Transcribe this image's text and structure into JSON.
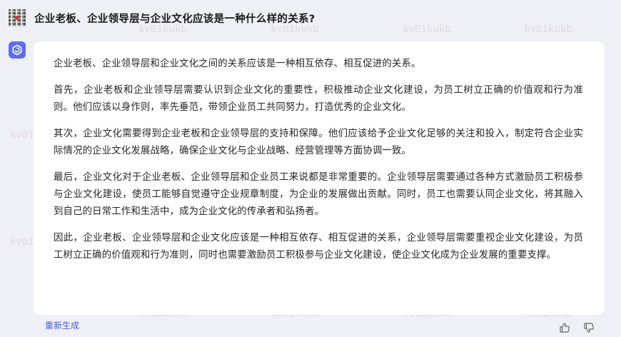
{
  "question": "企业老板、企业领导层与企业文化应该是一种什么样的关系?",
  "answer": {
    "paragraphs": [
      "企业老板、企业领导层和企业文化之间的关系应该是一种相互依存、相互促进的关系。",
      "首先，企业老板和企业领导层需要认识到企业文化的重要性，积极推动企业文化建设，为员工树立正确的价值观和行为准则。他们应该以身作则，率先垂范，带领企业员工共同努力，打造优秀的企业文化。",
      "其次，企业文化需要得到企业老板和企业领导层的支持和保障。他们应该给予企业文化足够的关注和投入，制定符合企业实际情况的企业文化发展战略，确保企业文化与企业战略、经营管理等方面协调一致。",
      "最后，企业文化对于企业老板、企业领导层和企业员工来说都是非常重要的。企业领导层需要通过各种方式激励员工积极参与企业文化建设，使员工能够自觉遵守企业规章制度，为企业的发展做出贡献。同时，员工也需要认同企业文化，将其融入到自己的日常工作和生活中，成为企业文化的传承者和弘扬者。",
      "因此，企业老板、企业领导层和企业文化应该是一种相互依存、相互促进的关系，企业领导层需要重视企业文化建设，为员工树立正确的价值观和行为准则，同时也需要激励员工积极参与企业文化建设，使企业文化成为企业发展的重要支撑。"
    ]
  },
  "actions": {
    "regenerate_label": "重新生成",
    "like_icon": "thumbs-up-icon",
    "dislike_icon": "thumbs-down-icon"
  },
  "watermark_text": "kv81kukb",
  "colors": {
    "background": "#eef0f6",
    "card": "#ffffff",
    "accent": "#4a5ae8",
    "bot_avatar": "#5b6cf5"
  }
}
